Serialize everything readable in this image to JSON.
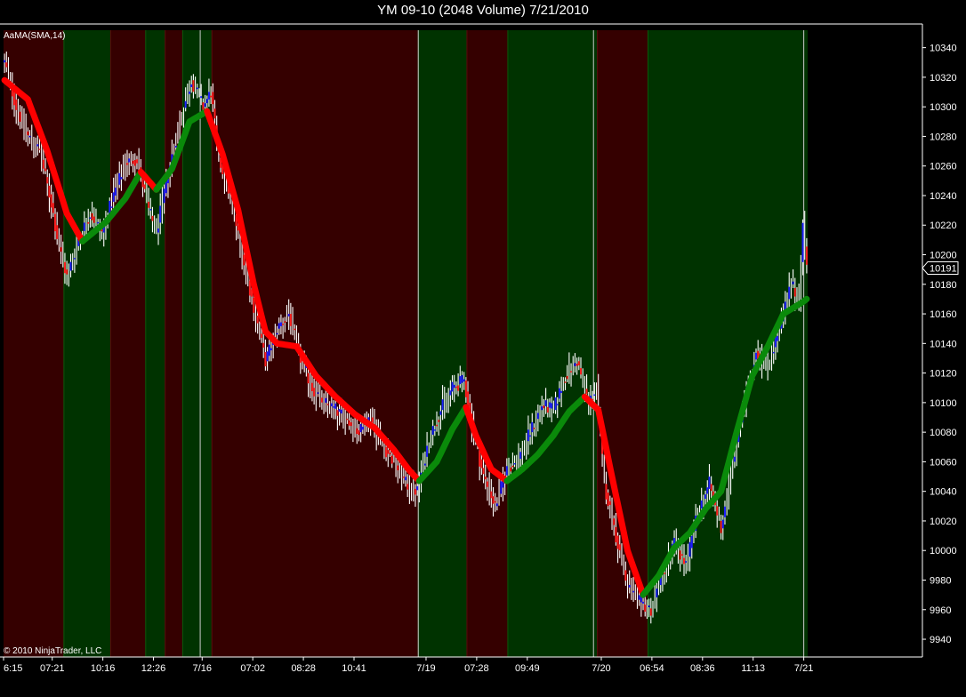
{
  "title": "YM 09-10 (2048 Volume)  7/21/2010",
  "indicator_label": "AaMA(SMA,14)",
  "copyright": "© 2010 NinjaTrader, LLC",
  "last_price_label": "10191",
  "colors": {
    "background": "#000000",
    "zone_up": "#003300",
    "zone_down": "#350000",
    "ma_up": "#0a8a0a",
    "ma_down": "#ff0000",
    "bar_up": "#1e1eff",
    "bar_down": "#ff2020",
    "bar_wick": "#ffffff",
    "axis": "#ffffff",
    "session_line": "#cccccc"
  },
  "chart_data": {
    "type": "ohlc",
    "title": "YM 09-10 (2048 Volume)  7/21/2010",
    "ylim": [
      9928,
      10356
    ],
    "y_ticks": [
      9940,
      9960,
      9980,
      10000,
      10020,
      10040,
      10060,
      10080,
      10100,
      10120,
      10140,
      10160,
      10180,
      10200,
      10220,
      10240,
      10260,
      10280,
      10300,
      10320,
      10340
    ],
    "x_ticks": [
      {
        "bar": 0,
        "label": "6:15"
      },
      {
        "bar": 25,
        "label": "07:21"
      },
      {
        "bar": 51,
        "label": "10:16"
      },
      {
        "bar": 77,
        "label": "12:26"
      },
      {
        "bar": 102,
        "label": "7/16"
      },
      {
        "bar": 128,
        "label": "07:02"
      },
      {
        "bar": 154,
        "label": "08:28"
      },
      {
        "bar": 180,
        "label": "10:41"
      },
      {
        "bar": 217,
        "label": "7/19"
      },
      {
        "bar": 243,
        "label": "07:28"
      },
      {
        "bar": 269,
        "label": "09:49"
      },
      {
        "bar": 307,
        "label": "7/20"
      },
      {
        "bar": 333,
        "label": "06:54"
      },
      {
        "bar": 359,
        "label": "08:36"
      },
      {
        "bar": 385,
        "label": "11:13"
      },
      {
        "bar": 411,
        "label": "7/21"
      }
    ],
    "bar_count": 413,
    "session_breaks": [
      101,
      213,
      303,
      411
    ],
    "ma_waypoints": [
      [
        0,
        10318
      ],
      [
        12,
        10305
      ],
      [
        22,
        10270
      ],
      [
        32,
        10228
      ],
      [
        40,
        10209
      ],
      [
        52,
        10222
      ],
      [
        62,
        10238
      ],
      [
        70,
        10256
      ],
      [
        78,
        10244
      ],
      [
        86,
        10258
      ],
      [
        95,
        10290
      ],
      [
        104,
        10297
      ],
      [
        112,
        10268
      ],
      [
        120,
        10230
      ],
      [
        128,
        10180
      ],
      [
        134,
        10148
      ],
      [
        140,
        10140
      ],
      [
        150,
        10138
      ],
      [
        160,
        10118
      ],
      [
        170,
        10104
      ],
      [
        180,
        10092
      ],
      [
        190,
        10083
      ],
      [
        200,
        10068
      ],
      [
        208,
        10054
      ],
      [
        213,
        10047
      ],
      [
        222,
        10060
      ],
      [
        230,
        10082
      ],
      [
        237,
        10097
      ],
      [
        242,
        10078
      ],
      [
        250,
        10055
      ],
      [
        258,
        10047
      ],
      [
        266,
        10055
      ],
      [
        274,
        10065
      ],
      [
        282,
        10078
      ],
      [
        290,
        10094
      ],
      [
        298,
        10104
      ],
      [
        305,
        10095
      ],
      [
        312,
        10050
      ],
      [
        320,
        10000
      ],
      [
        328,
        9970
      ],
      [
        336,
        9983
      ],
      [
        344,
        10002
      ],
      [
        352,
        10012
      ],
      [
        360,
        10028
      ],
      [
        368,
        10040
      ],
      [
        376,
        10080
      ],
      [
        384,
        10118
      ],
      [
        392,
        10138
      ],
      [
        400,
        10160
      ],
      [
        410,
        10168
      ],
      [
        412,
        10170
      ]
    ],
    "price_waypoints": [
      [
        0,
        10330
      ],
      [
        6,
        10300
      ],
      [
        12,
        10280
      ],
      [
        18,
        10270
      ],
      [
        24,
        10235
      ],
      [
        28,
        10205
      ],
      [
        32,
        10185
      ],
      [
        38,
        10210
      ],
      [
        44,
        10228
      ],
      [
        50,
        10215
      ],
      [
        56,
        10240
      ],
      [
        62,
        10262
      ],
      [
        68,
        10265
      ],
      [
        74,
        10230
      ],
      [
        78,
        10215
      ],
      [
        84,
        10255
      ],
      [
        90,
        10290
      ],
      [
        96,
        10318
      ],
      [
        102,
        10300
      ],
      [
        106,
        10310
      ],
      [
        110,
        10265
      ],
      [
        116,
        10240
      ],
      [
        122,
        10200
      ],
      [
        128,
        10165
      ],
      [
        134,
        10128
      ],
      [
        140,
        10150
      ],
      [
        146,
        10160
      ],
      [
        152,
        10130
      ],
      [
        158,
        10110
      ],
      [
        164,
        10100
      ],
      [
        170,
        10095
      ],
      [
        176,
        10088
      ],
      [
        182,
        10080
      ],
      [
        188,
        10090
      ],
      [
        194,
        10072
      ],
      [
        200,
        10060
      ],
      [
        206,
        10045
      ],
      [
        212,
        10040
      ],
      [
        218,
        10075
      ],
      [
        224,
        10095
      ],
      [
        230,
        10110
      ],
      [
        236,
        10115
      ],
      [
        240,
        10085
      ],
      [
        246,
        10050
      ],
      [
        252,
        10030
      ],
      [
        258,
        10055
      ],
      [
        264,
        10062
      ],
      [
        270,
        10080
      ],
      [
        276,
        10098
      ],
      [
        282,
        10095
      ],
      [
        288,
        10118
      ],
      [
        294,
        10128
      ],
      [
        300,
        10100
      ],
      [
        304,
        10110
      ],
      [
        308,
        10045
      ],
      [
        314,
        10010
      ],
      [
        320,
        9975
      ],
      [
        326,
        9965
      ],
      [
        332,
        9960
      ],
      [
        338,
        9985
      ],
      [
        344,
        10005
      ],
      [
        350,
        9990
      ],
      [
        356,
        10025
      ],
      [
        362,
        10045
      ],
      [
        368,
        10015
      ],
      [
        374,
        10060
      ],
      [
        380,
        10100
      ],
      [
        386,
        10135
      ],
      [
        392,
        10125
      ],
      [
        398,
        10150
      ],
      [
        404,
        10180
      ],
      [
        408,
        10170
      ],
      [
        410,
        10220
      ],
      [
        412,
        10191
      ]
    ],
    "zones": [
      {
        "from": 0,
        "to": 31,
        "dir": "down"
      },
      {
        "from": 31,
        "to": 55,
        "dir": "up"
      },
      {
        "from": 55,
        "to": 73,
        "dir": "down"
      },
      {
        "from": 73,
        "to": 83,
        "dir": "up"
      },
      {
        "from": 83,
        "to": 92,
        "dir": "down"
      },
      {
        "from": 92,
        "to": 107,
        "dir": "up"
      },
      {
        "from": 107,
        "to": 213,
        "dir": "down"
      },
      {
        "from": 213,
        "to": 238,
        "dir": "up"
      },
      {
        "from": 238,
        "to": 259,
        "dir": "down"
      },
      {
        "from": 259,
        "to": 305,
        "dir": "up"
      },
      {
        "from": 305,
        "to": 331,
        "dir": "down"
      },
      {
        "from": 331,
        "to": 413,
        "dir": "up"
      }
    ]
  }
}
